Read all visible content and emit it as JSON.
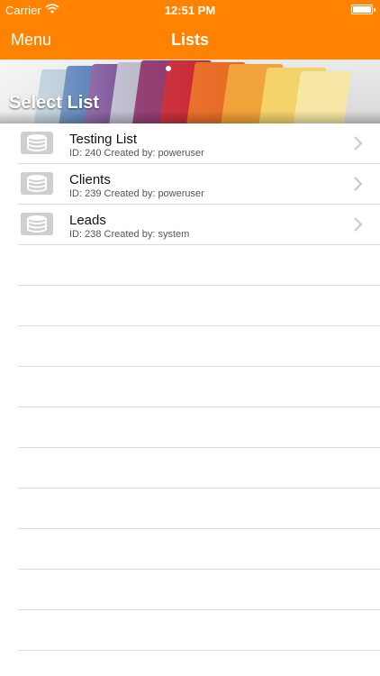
{
  "status_bar": {
    "carrier": "Carrier",
    "time": "12:51 PM"
  },
  "nav": {
    "menu_label": "Menu",
    "title": "Lists"
  },
  "banner": {
    "heading": "Select List"
  },
  "lists": [
    {
      "title": "Testing List",
      "subtitle": "ID: 240 Created by: poweruser"
    },
    {
      "title": "Clients",
      "subtitle": "ID: 239 Created by: poweruser"
    },
    {
      "title": "Leads",
      "subtitle": "ID: 238 Created by: system"
    }
  ],
  "colors": {
    "accent": "#ff8200",
    "separator": "#dcdcdc",
    "icon_bg": "#cfcfcf"
  }
}
